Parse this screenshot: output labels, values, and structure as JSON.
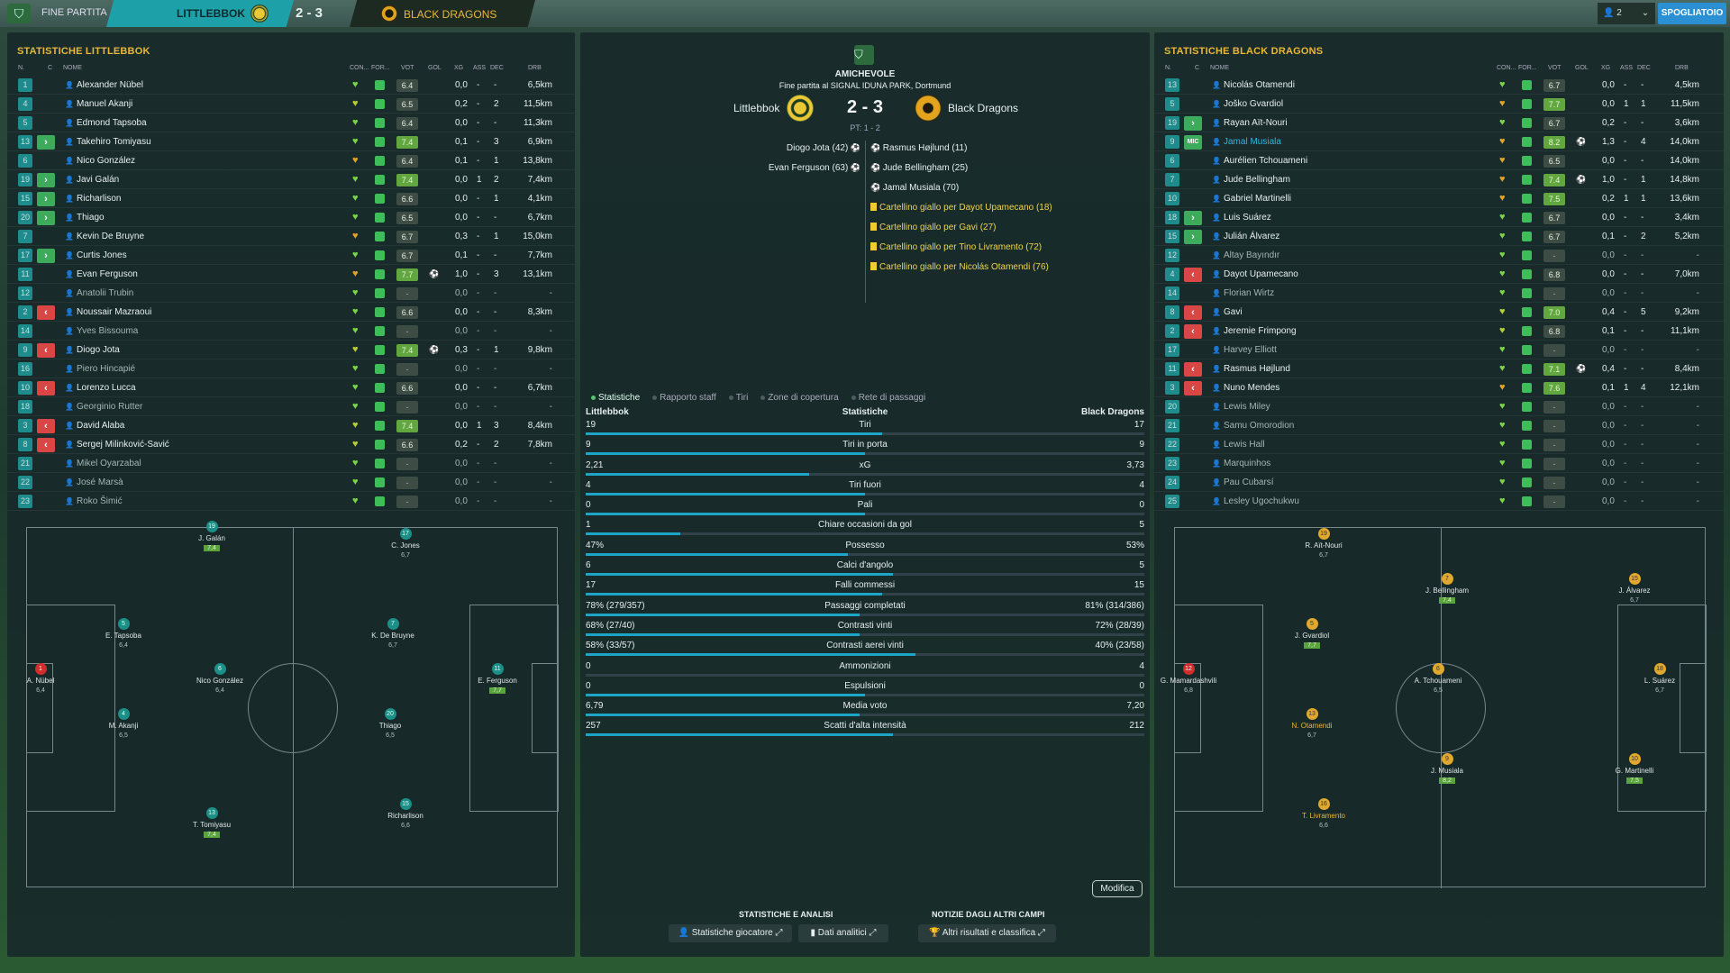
{
  "topbar": {
    "title": "FINE PARTITA",
    "home_team": "LITTLEBBOK",
    "score": "2 - 3",
    "away_team": "BLACK DRAGONS",
    "notif": "2",
    "dressing_room": "SPOGLIATOIO"
  },
  "headers": {
    "num": "N.",
    "c": "C",
    "name": "NOME",
    "con": "CON...",
    "form": "FOR...",
    "vot": "VOT",
    "gol": "GOL",
    "xg": "XG",
    "ass": "ASS",
    "dec": "DEC",
    "drb": "DRB"
  },
  "left": {
    "title": "STATISTICHE LITTLEBBOK",
    "players": [
      {
        "n": "1",
        "chg": "",
        "name": "Alexander Nübel",
        "heart": "g",
        "vot": "6.4",
        "gol": "",
        "xg": "0,0",
        "ass": "-",
        "dec": "-",
        "drb": "6,5km"
      },
      {
        "n": "4",
        "chg": "",
        "name": "Manuel Akanji",
        "heart": "y",
        "vot": "6.5",
        "gol": "",
        "xg": "0,2",
        "ass": "-",
        "dec": "2",
        "drb": "11,5km"
      },
      {
        "n": "5",
        "chg": "",
        "name": "Edmond Tapsoba",
        "heart": "g",
        "vot": "6.4",
        "gol": "",
        "xg": "0,0",
        "ass": "-",
        "dec": "-",
        "drb": "11,3km"
      },
      {
        "n": "13",
        "chg": "in",
        "name": "Takehiro Tomiyasu",
        "heart": "g",
        "vot": "7.4",
        "gol": "",
        "xg": "0,1",
        "ass": "-",
        "dec": "3",
        "drb": "6,9km"
      },
      {
        "n": "6",
        "chg": "",
        "name": "Nico González",
        "heart": "o",
        "vot": "6.4",
        "gol": "",
        "xg": "0,1",
        "ass": "-",
        "dec": "1",
        "drb": "13,8km"
      },
      {
        "n": "19",
        "chg": "in",
        "name": "Javi Galán",
        "heart": "g",
        "vot": "7.4",
        "gol": "",
        "xg": "0,0",
        "ass": "1",
        "dec": "2",
        "drb": "7,4km"
      },
      {
        "n": "15",
        "chg": "in",
        "name": "Richarlison",
        "heart": "g",
        "vot": "6.6",
        "gol": "",
        "xg": "0,0",
        "ass": "-",
        "dec": "1",
        "drb": "4,1km"
      },
      {
        "n": "20",
        "chg": "in",
        "name": "Thiago",
        "heart": "g",
        "vot": "6.5",
        "gol": "",
        "xg": "0,0",
        "ass": "-",
        "dec": "-",
        "drb": "6,7km"
      },
      {
        "n": "7",
        "chg": "",
        "name": "Kevin De Bruyne",
        "heart": "o",
        "vot": "6.7",
        "gol": "",
        "xg": "0,3",
        "ass": "-",
        "dec": "1",
        "drb": "15,0km"
      },
      {
        "n": "17",
        "chg": "in",
        "name": "Curtis Jones",
        "heart": "g",
        "vot": "6.7",
        "gol": "",
        "xg": "0,1",
        "ass": "-",
        "dec": "-",
        "drb": "7,7km"
      },
      {
        "n": "11",
        "chg": "",
        "name": "Evan Ferguson",
        "heart": "o",
        "vot": "7.7",
        "gol": "⚽",
        "xg": "1,0",
        "ass": "-",
        "dec": "3",
        "drb": "13,1km"
      },
      {
        "n": "12",
        "chg": "",
        "name": "Anatolii Trubin",
        "heart": "g",
        "vot": "-",
        "gol": "",
        "xg": "0,0",
        "ass": "-",
        "dec": "-",
        "drb": "-"
      },
      {
        "n": "2",
        "chg": "out",
        "name": "Noussair Mazraoui",
        "heart": "g",
        "vot": "6.6",
        "gol": "",
        "xg": "0,0",
        "ass": "-",
        "dec": "-",
        "drb": "8,3km"
      },
      {
        "n": "14",
        "chg": "",
        "name": "Yves Bissouma",
        "heart": "g",
        "vot": "-",
        "gol": "",
        "xg": "0,0",
        "ass": "-",
        "dec": "-",
        "drb": "-"
      },
      {
        "n": "9",
        "chg": "out",
        "name": "Diogo Jota",
        "heart": "y",
        "vot": "7.4",
        "gol": "⚽",
        "xg": "0,3",
        "ass": "-",
        "dec": "1",
        "drb": "9,8km"
      },
      {
        "n": "16",
        "chg": "",
        "name": "Piero Hincapié",
        "heart": "g",
        "vot": "-",
        "gol": "",
        "xg": "0,0",
        "ass": "-",
        "dec": "-",
        "drb": "-"
      },
      {
        "n": "10",
        "chg": "out",
        "name": "Lorenzo Lucca",
        "heart": "g",
        "vot": "6.6",
        "gol": "",
        "xg": "0,0",
        "ass": "-",
        "dec": "-",
        "drb": "6,7km"
      },
      {
        "n": "18",
        "chg": "",
        "name": "Georginio Rutter",
        "heart": "g",
        "vot": "-",
        "gol": "",
        "xg": "0,0",
        "ass": "-",
        "dec": "-",
        "drb": "-"
      },
      {
        "n": "3",
        "chg": "out",
        "name": "David Alaba",
        "heart": "y",
        "vot": "7.4",
        "gol": "",
        "xg": "0,0",
        "ass": "1",
        "dec": "3",
        "drb": "8,4km"
      },
      {
        "n": "8",
        "chg": "out",
        "name": "Sergej Milinković-Savić",
        "heart": "y",
        "vot": "6.6",
        "gol": "",
        "xg": "0,2",
        "ass": "-",
        "dec": "2",
        "drb": "7,8km"
      },
      {
        "n": "21",
        "chg": "",
        "name": "Mikel Oyarzabal",
        "heart": "g",
        "vot": "-",
        "gol": "",
        "xg": "0,0",
        "ass": "-",
        "dec": "-",
        "drb": "-"
      },
      {
        "n": "22",
        "chg": "",
        "name": "José Marsà",
        "heart": "g",
        "vot": "-",
        "gol": "",
        "xg": "0,0",
        "ass": "-",
        "dec": "-",
        "drb": "-"
      },
      {
        "n": "23",
        "chg": "",
        "name": "Roko Šimić",
        "heart": "g",
        "vot": "-",
        "gol": "",
        "xg": "0,0",
        "ass": "-",
        "dec": "-",
        "drb": "-"
      }
    ],
    "pitch": [
      {
        "num": "19",
        "name": "J. Galán",
        "vot": "7,4",
        "good": true,
        "col": "t"
      },
      {
        "num": "17",
        "name": "C. Jones",
        "vot": "6,7",
        "good": false,
        "col": "t"
      },
      {
        "num": "5",
        "name": "E. Tapsoba",
        "vot": "6,4",
        "good": false,
        "col": "t"
      },
      {
        "num": "7",
        "name": "K. De Bruyne",
        "vot": "6,7",
        "good": false,
        "col": "t"
      },
      {
        "num": "1",
        "name": "A. Nübel",
        "vot": "6,4",
        "good": false,
        "col": "r"
      },
      {
        "num": "6",
        "name": "Nico González",
        "vot": "6,4",
        "good": false,
        "col": "t"
      },
      {
        "num": "11",
        "name": "E. Ferguson",
        "vot": "7,7",
        "good": true,
        "col": "t"
      },
      {
        "num": "4",
        "name": "M. Akanji",
        "vot": "6,5",
        "good": false,
        "col": "t"
      },
      {
        "num": "20",
        "name": "Thiago",
        "vot": "6,5",
        "good": false,
        "col": "t"
      },
      {
        "num": "15",
        "name": "Richarlison",
        "vot": "6,6",
        "good": false,
        "col": "t"
      },
      {
        "num": "13",
        "name": "T. Tomiyasu",
        "vot": "7,4",
        "good": true,
        "col": "t"
      }
    ]
  },
  "right": {
    "title": "STATISTICHE BLACK DRAGONS",
    "players": [
      {
        "n": "13",
        "chg": "",
        "name": "Nicolás Otamendi",
        "heart": "g",
        "vot": "6.7",
        "gol": "",
        "xg": "0,0",
        "ass": "-",
        "dec": "-",
        "drb": "4,5km",
        "hl": false
      },
      {
        "n": "5",
        "chg": "",
        "name": "Joško Gvardiol",
        "heart": "o",
        "vot": "7.7",
        "gol": "",
        "xg": "0,0",
        "ass": "1",
        "dec": "1",
        "drb": "11,5km",
        "hl": false
      },
      {
        "n": "19",
        "chg": "in",
        "name": "Rayan Aït-Nouri",
        "heart": "g",
        "vot": "6.7",
        "gol": "",
        "xg": "0,2",
        "ass": "-",
        "dec": "-",
        "drb": "3,6km",
        "hl": false
      },
      {
        "n": "9",
        "chg": "mic",
        "name": "Jamal Musiala",
        "heart": "o",
        "vot": "8.2",
        "gol": "⚽",
        "xg": "1,3",
        "ass": "-",
        "dec": "4",
        "drb": "14,0km",
        "hl": true
      },
      {
        "n": "6",
        "chg": "",
        "name": "Aurélien Tchouameni",
        "heart": "o",
        "vot": "6.5",
        "gol": "",
        "xg": "0,0",
        "ass": "-",
        "dec": "-",
        "drb": "14,0km",
        "hl": false
      },
      {
        "n": "7",
        "chg": "",
        "name": "Jude Bellingham",
        "heart": "o",
        "vot": "7.4",
        "gol": "⚽",
        "xg": "1,0",
        "ass": "-",
        "dec": "1",
        "drb": "14,8km",
        "hl": false
      },
      {
        "n": "10",
        "chg": "",
        "name": "Gabriel Martinelli",
        "heart": "o",
        "vot": "7.5",
        "gol": "",
        "xg": "0,2",
        "ass": "1",
        "dec": "1",
        "drb": "13,6km",
        "hl": false
      },
      {
        "n": "18",
        "chg": "in",
        "name": "Luis Suárez",
        "heart": "g",
        "vot": "6.7",
        "gol": "",
        "xg": "0,0",
        "ass": "-",
        "dec": "-",
        "drb": "3,4km",
        "hl": false
      },
      {
        "n": "15",
        "chg": "in",
        "name": "Julián Álvarez",
        "heart": "g",
        "vot": "6.7",
        "gol": "",
        "xg": "0,1",
        "ass": "-",
        "dec": "2",
        "drb": "5,2km",
        "hl": false
      },
      {
        "n": "12",
        "chg": "",
        "name": "Altay Bayındır",
        "heart": "g",
        "vot": "-",
        "gol": "",
        "xg": "0,0",
        "ass": "-",
        "dec": "-",
        "drb": "-",
        "hl": false
      },
      {
        "n": "4",
        "chg": "out",
        "name": "Dayot Upamecano",
        "heart": "g",
        "vot": "6.8",
        "gol": "",
        "xg": "0,0",
        "ass": "-",
        "dec": "-",
        "drb": "7,0km",
        "hl": false
      },
      {
        "n": "14",
        "chg": "",
        "name": "Florian Wirtz",
        "heart": "g",
        "vot": "-",
        "gol": "",
        "xg": "0,0",
        "ass": "-",
        "dec": "-",
        "drb": "-",
        "hl": false
      },
      {
        "n": "8",
        "chg": "out",
        "name": "Gavi",
        "heart": "y",
        "vot": "7.0",
        "gol": "",
        "xg": "0,4",
        "ass": "-",
        "dec": "5",
        "drb": "9,2km",
        "hl": false
      },
      {
        "n": "2",
        "chg": "out",
        "name": "Jeremie Frimpong",
        "heart": "y",
        "vot": "6.8",
        "gol": "",
        "xg": "0,1",
        "ass": "-",
        "dec": "-",
        "drb": "11,1km",
        "hl": false
      },
      {
        "n": "17",
        "chg": "",
        "name": "Harvey Elliott",
        "heart": "g",
        "vot": "-",
        "gol": "",
        "xg": "0,0",
        "ass": "-",
        "dec": "-",
        "drb": "-",
        "hl": false
      },
      {
        "n": "11",
        "chg": "out",
        "name": "Rasmus Højlund",
        "heart": "g",
        "vot": "7.1",
        "gol": "⚽",
        "xg": "0,4",
        "ass": "-",
        "dec": "-",
        "drb": "8,4km",
        "hl": false
      },
      {
        "n": "3",
        "chg": "out",
        "name": "Nuno Mendes",
        "heart": "o",
        "vot": "7.6",
        "gol": "",
        "xg": "0,1",
        "ass": "1",
        "dec": "4",
        "drb": "12,1km",
        "hl": false
      },
      {
        "n": "20",
        "chg": "",
        "name": "Lewis Miley",
        "heart": "g",
        "vot": "-",
        "gol": "",
        "xg": "0,0",
        "ass": "-",
        "dec": "-",
        "drb": "-",
        "hl": false
      },
      {
        "n": "21",
        "chg": "",
        "name": "Samu Omorodion",
        "heart": "g",
        "vot": "-",
        "gol": "",
        "xg": "0,0",
        "ass": "-",
        "dec": "-",
        "drb": "-",
        "hl": false
      },
      {
        "n": "22",
        "chg": "",
        "name": "Lewis Hall",
        "heart": "g",
        "vot": "-",
        "gol": "",
        "xg": "0,0",
        "ass": "-",
        "dec": "-",
        "drb": "-",
        "hl": false
      },
      {
        "n": "23",
        "chg": "",
        "name": "Marquinhos",
        "heart": "g",
        "vot": "-",
        "gol": "",
        "xg": "0,0",
        "ass": "-",
        "dec": "-",
        "drb": "-",
        "hl": false
      },
      {
        "n": "24",
        "chg": "",
        "name": "Pau Cubarsí",
        "heart": "g",
        "vot": "-",
        "gol": "",
        "xg": "0,0",
        "ass": "-",
        "dec": "-",
        "drb": "-",
        "hl": false
      },
      {
        "n": "25",
        "chg": "",
        "name": "Lesley Ugochukwu",
        "heart": "g",
        "vot": "-",
        "gol": "",
        "xg": "0,0",
        "ass": "-",
        "dec": "-",
        "drb": "-",
        "hl": false
      }
    ],
    "pitch": [
      {
        "num": "19",
        "name": "R. Aït-Nouri",
        "vot": "6,7",
        "good": false,
        "col": "o"
      },
      {
        "num": "7",
        "name": "J. Bellingham",
        "vot": "7,4",
        "good": true,
        "col": "o"
      },
      {
        "num": "15",
        "name": "J. Álvarez",
        "vot": "6,7",
        "good": false,
        "col": "o"
      },
      {
        "num": "5",
        "name": "J. Gvardiol",
        "vot": "7,7",
        "good": true,
        "col": "o"
      },
      {
        "num": "12",
        "name": "G. Mamardashvili",
        "vot": "6,8",
        "good": false,
        "col": "r"
      },
      {
        "num": "6",
        "name": "A. Tchouameni",
        "vot": "6,5",
        "good": false,
        "col": "o"
      },
      {
        "num": "18",
        "name": "L. Suárez",
        "vot": "6,7",
        "good": false,
        "col": "o"
      },
      {
        "num": "13",
        "name": "N. Otamendi",
        "vot": "6,7",
        "good": false,
        "col": "o",
        "orange": true
      },
      {
        "num": "9",
        "name": "J. Musiala",
        "vot": "8,2",
        "good": true,
        "col": "o"
      },
      {
        "num": "10",
        "name": "G. Martinelli",
        "vot": "7,5",
        "good": true,
        "col": "o"
      },
      {
        "num": "16",
        "name": "T. Livramento",
        "vot": "6,6",
        "good": false,
        "col": "o",
        "orange": true
      }
    ]
  },
  "match": {
    "competition": "AMICHEVOLE",
    "venue": "Fine partita al SIGNAL IDUNA PARK, Dortmund",
    "home": "Littlebbok",
    "score": "2 - 3",
    "away": "Black Dragons",
    "halftime": "PT: 1 - 2",
    "home_events": [
      "Diogo Jota (42)",
      "Evan Ferguson (63)"
    ],
    "away_goals": [
      "Rasmus Højlund (11)",
      "Jude Bellingham (25)",
      "Jamal Musiala (70)"
    ],
    "away_cards": [
      "Cartellino giallo per Dayot Upamecano (18)",
      "Cartellino giallo per Gavi (27)",
      "Cartellino giallo per Tino Livramento (72)",
      "Cartellino giallo per Nicolás Otamendi (76)"
    ]
  },
  "tabs": [
    "Statistiche",
    "Rapporto staff",
    "Tiri",
    "Zone di copertura",
    "Rete di passaggi"
  ],
  "stats_header": {
    "home": "Littlebbok",
    "title": "Statistiche",
    "away": "Black Dragons"
  },
  "stats": [
    {
      "label": "Tiri",
      "home": "19",
      "away": "17",
      "share": 0.53
    },
    {
      "label": "Tiri in porta",
      "home": "9",
      "away": "9",
      "share": 0.5
    },
    {
      "label": "xG",
      "home": "2,21",
      "away": "3,73",
      "share": 0.4
    },
    {
      "label": "Tiri fuori",
      "home": "4",
      "away": "4",
      "share": 0.5
    },
    {
      "label": "Pali",
      "home": "0",
      "away": "0",
      "share": 0.5
    },
    {
      "label": "Chiare occasioni da gol",
      "home": "1",
      "away": "5",
      "share": 0.17
    },
    {
      "label": "Possesso",
      "home": "47%",
      "away": "53%",
      "share": 0.47
    },
    {
      "label": "Calci d'angolo",
      "home": "6",
      "away": "5",
      "share": 0.55
    },
    {
      "label": "Falli commessi",
      "home": "17",
      "away": "15",
      "share": 0.53
    },
    {
      "label": "Passaggi completati",
      "home": "78% (279/357)",
      "away": "81% (314/386)",
      "share": 0.49
    },
    {
      "label": "Contrasti vinti",
      "home": "68% (27/40)",
      "away": "72% (28/39)",
      "share": 0.49
    },
    {
      "label": "Contrasti aerei vinti",
      "home": "58% (33/57)",
      "away": "40% (23/58)",
      "share": 0.59
    },
    {
      "label": "Ammonizioni",
      "home": "0",
      "away": "4",
      "share": 0.0
    },
    {
      "label": "Espulsioni",
      "home": "0",
      "away": "0",
      "share": 0.5
    },
    {
      "label": "Media voto",
      "home": "6,79",
      "away": "7,20",
      "share": 0.49
    },
    {
      "label": "Scatti d'alta intensità",
      "home": "257",
      "away": "212",
      "share": 0.55
    }
  ],
  "modifica": "Modifica",
  "bottom": {
    "analysis_title": "STATISTICHE E ANALISI",
    "other_title": "NOTIZIE DAGLI ALTRI CAMPI",
    "btn_player": "Statistiche giocatore",
    "btn_data": "Dati analitici",
    "btn_results": "Altri risultati e classifica"
  },
  "colors": {
    "accent": "#1ba5c6",
    "title": "#e9b73a",
    "good": "#62a640",
    "sub_in": "#3eab5c",
    "sub_out": "#d94646"
  }
}
